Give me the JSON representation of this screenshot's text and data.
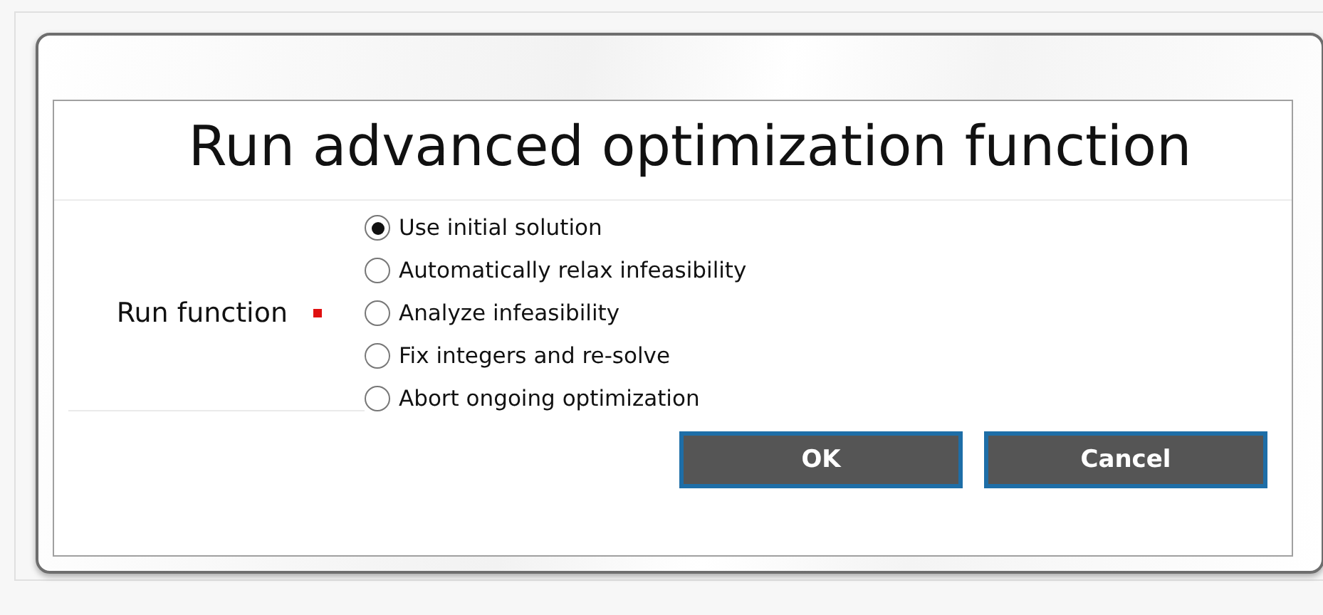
{
  "dialog": {
    "title": "Run advanced optimization function"
  },
  "field": {
    "label": "Run function",
    "required": true,
    "options": [
      {
        "label": "Use initial solution",
        "selected": true
      },
      {
        "label": "Automatically relax infeasibility",
        "selected": false
      },
      {
        "label": "Analyze infeasibility",
        "selected": false
      },
      {
        "label": "Fix integers and re-solve",
        "selected": false
      },
      {
        "label": "Abort ongoing optimization",
        "selected": false
      }
    ]
  },
  "buttons": [
    "OK",
    "Cancel"
  ]
}
